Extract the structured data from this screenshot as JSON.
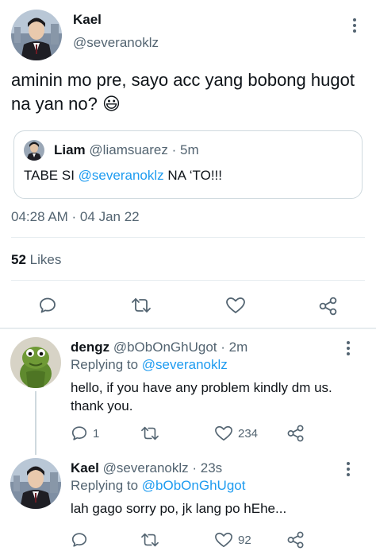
{
  "tweet": {
    "author_name": "Kael",
    "author_handle": "@severanoklz",
    "text": "aminin mo pre, sayo acc yang bobong hugot na yan no? 😃",
    "quote": {
      "author_name": "Liam",
      "author_handle": "@liamsuarez",
      "separator": "·",
      "time": "5m",
      "text_prefix": "TABE SI ",
      "text_mention": "@severanoklz",
      "text_suffix": " NA ‘TO!!!"
    },
    "timestamp": "04:28 AM · 04 Jan 22",
    "likes_count": "52",
    "likes_label": "Likes"
  },
  "replies": [
    {
      "author_name": "dengz",
      "author_handle": "@bObOnGhUgot",
      "separator": "·",
      "time": "2m",
      "replying_label": "Replying to",
      "replying_to": "@severanoklz",
      "text": "hello, if you have any problem kindly dm us. thank you.",
      "reply_count": "1",
      "retweet_count": "",
      "like_count": "234"
    },
    {
      "author_name": "Kael",
      "author_handle": "@severanoklz",
      "separator": "·",
      "time": "23s",
      "replying_label": "Replying to",
      "replying_to": "@bObOnGhUgot",
      "text": "lah gago sorry po, jk lang po hEhe...",
      "reply_count": "",
      "retweet_count": "",
      "like_count": "92"
    }
  ],
  "icons": {
    "more": "more-vertical-icon",
    "reply": "comment-bubble-icon",
    "retweet": "retweet-icon",
    "like": "heart-icon",
    "share": "share-icon"
  },
  "colors": {
    "link": "#1d9bf0",
    "muted": "#536471",
    "text": "#0f1419",
    "divider": "#e6ecf0"
  }
}
